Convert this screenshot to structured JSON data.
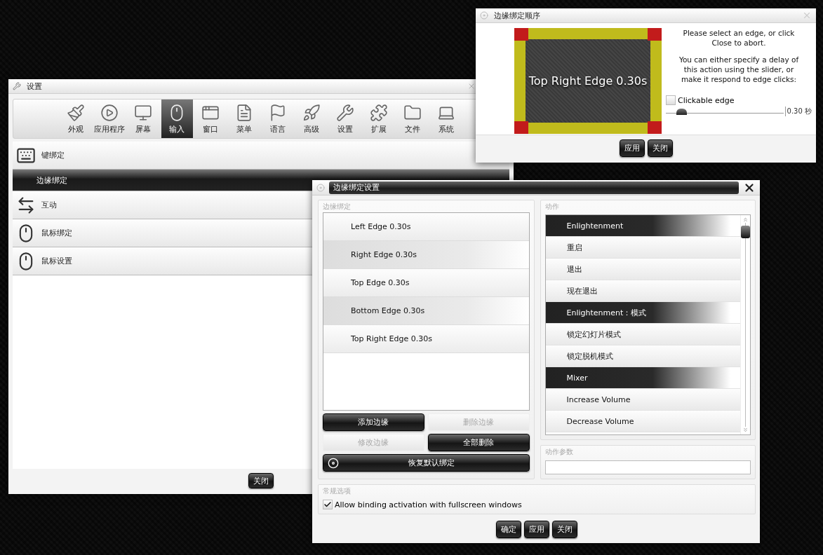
{
  "settings_window": {
    "title": "设置",
    "toolbar": [
      {
        "label": "外观",
        "selected": false
      },
      {
        "label": "应用程序",
        "selected": false
      },
      {
        "label": "屏幕",
        "selected": false
      },
      {
        "label": "输入",
        "selected": true
      },
      {
        "label": "窗口",
        "selected": false
      },
      {
        "label": "菜单",
        "selected": false
      },
      {
        "label": "语言",
        "selected": false
      },
      {
        "label": "高级",
        "selected": false
      },
      {
        "label": "设置",
        "selected": false
      },
      {
        "label": "扩展",
        "selected": false
      },
      {
        "label": "文件",
        "selected": false
      },
      {
        "label": "系统",
        "selected": false
      }
    ],
    "list": [
      {
        "label": "键绑定",
        "selected": false
      },
      {
        "label": "边缘绑定",
        "selected": true
      },
      {
        "label": "互动",
        "selected": false
      },
      {
        "label": "鼠标绑定",
        "selected": false
      },
      {
        "label": "鼠标设置",
        "selected": false
      }
    ],
    "buttons": [
      "关闭"
    ]
  },
  "edge_order_window": {
    "title": "边缘绑定顺序",
    "preview_label": "Top Right Edge 0.30s",
    "instructions": [
      "Please select an edge, or click Close to abort.",
      "You can either specify a delay of this action using the slider, or make it respond to edge clicks:"
    ],
    "clickable_edge": {
      "label": "Clickable edge",
      "checked": false
    },
    "delay": {
      "level": 0.1,
      "reading": "0.30 秒"
    },
    "buttons": [
      "应用",
      "关闭"
    ]
  },
  "edge_settings_dialog": {
    "title": "边缘绑定设置",
    "edges_group": {
      "title": "边缘绑定",
      "edges": [
        "Left Edge 0.30s",
        "Right Edge 0.30s",
        "Top Edge 0.30s",
        "Bottom Edge 0.30s",
        "Top Right Edge 0.30s"
      ],
      "buttons": [
        {
          "label": "添加边缘",
          "disabled": false
        },
        {
          "label": "删除边缘",
          "disabled": true
        },
        {
          "label": "修改边缘",
          "disabled": true
        },
        {
          "label": "全部删除",
          "disabled": false
        }
      ],
      "restore_button": "恢复默认绑定"
    },
    "actions_group": {
      "title": "动作",
      "actions": [
        {
          "label": "Enlightenment",
          "kind": "group"
        },
        {
          "label": "重启",
          "kind": "action"
        },
        {
          "label": "退出",
          "kind": "action"
        },
        {
          "label": "现在退出",
          "kind": "action"
        },
        {
          "label": "Enlightenment：模式",
          "kind": "group"
        },
        {
          "label": "锁定幻灯片模式",
          "kind": "action"
        },
        {
          "label": "锁定脱机模式",
          "kind": "action"
        },
        {
          "label": "Mixer",
          "kind": "group"
        },
        {
          "label": "Increase Volume",
          "kind": "action"
        },
        {
          "label": "Decrease Volume",
          "kind": "action"
        }
      ]
    },
    "params_group": {
      "title": "动作参数"
    },
    "general_group": {
      "title": "常规选项",
      "fullscreen_option": {
        "label": "Allow binding activation with fullscreen windows",
        "checked": true
      }
    },
    "buttons": [
      "确定",
      "应用",
      "关闭"
    ]
  }
}
